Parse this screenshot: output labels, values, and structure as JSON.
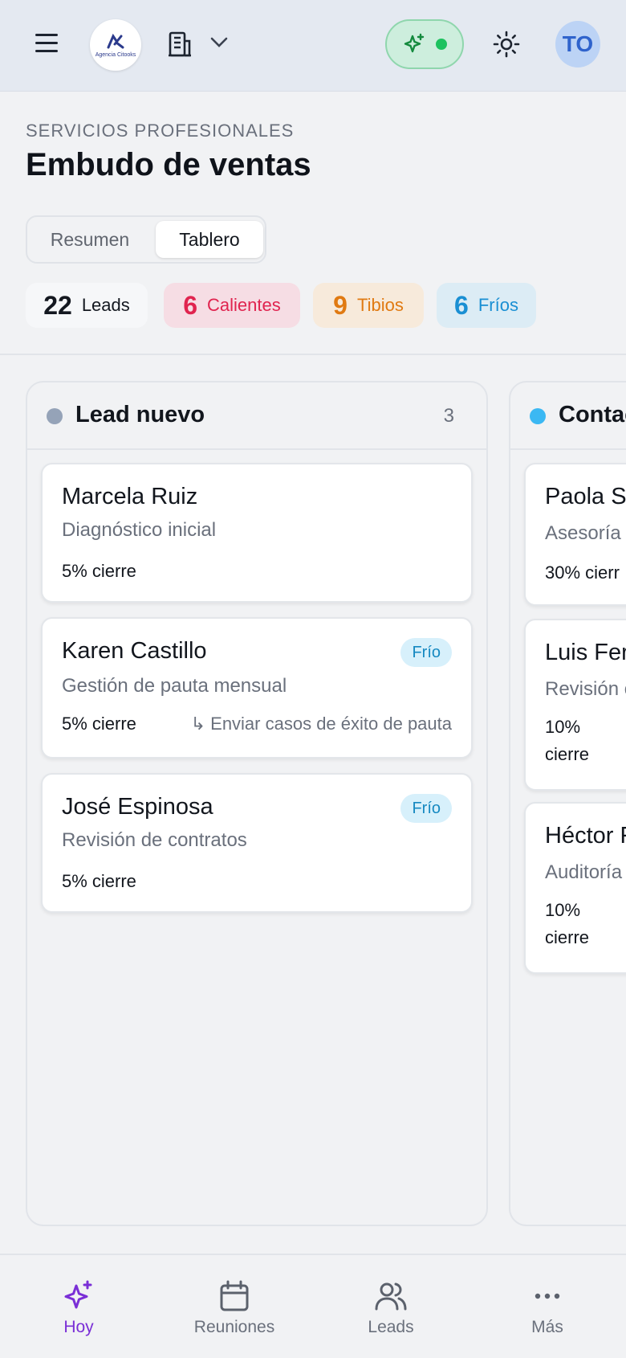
{
  "header": {
    "logo_text": "Agencia Citooks",
    "avatar_initials": "TO"
  },
  "page": {
    "eyebrow": "SERVICIOS PROFESIONALES",
    "title": "Embudo de ventas",
    "tabs": [
      {
        "label": "Resumen",
        "active": false
      },
      {
        "label": "Tablero",
        "active": true
      }
    ]
  },
  "stats": [
    {
      "value": "22",
      "label": "Leads",
      "color": "#141820",
      "bg": "#f6f7f9"
    },
    {
      "value": "6",
      "label": "Calientes",
      "color": "#e0244f",
      "bg": "#f6dde4"
    },
    {
      "value": "9",
      "label": "Tibios",
      "color": "#e07a12",
      "bg": "#f7eadb"
    },
    {
      "value": "6",
      "label": "Fríos",
      "color": "#1a8fd3",
      "bg": "#dcecf5"
    }
  ],
  "columns": [
    {
      "title": "Lead nuevo",
      "count": "3",
      "dot_color": "#95a3b8",
      "cards": [
        {
          "name": "Marcela Ruiz",
          "sub": "Diagnóstico inicial",
          "pct": "5% cierre",
          "badge": "",
          "next": ""
        },
        {
          "name": "Karen Castillo",
          "sub": "Gestión de pauta mensual",
          "pct": "5% cierre",
          "badge": "Frío",
          "next": "↳ Enviar casos de éxito de pauta"
        },
        {
          "name": "José Espinosa",
          "sub": "Revisión de contratos",
          "pct": "5% cierre",
          "badge": "Frío",
          "next": ""
        }
      ]
    },
    {
      "title": "Contac",
      "count": "",
      "dot_color": "#3bb8f3",
      "cards": [
        {
          "name": "Paola Sa",
          "sub": "Asesoría",
          "pct": "30% cierr"
        },
        {
          "name": "Luis Fer",
          "sub": "Revisión c",
          "pct": "10% cierre"
        },
        {
          "name": "Héctor F",
          "sub": "Auditoría",
          "pct": "10% cierre"
        }
      ]
    }
  ],
  "bottom_nav": [
    {
      "label": "Hoy",
      "icon": "sparkle-icon",
      "active": true
    },
    {
      "label": "Reuniones",
      "icon": "calendar-icon",
      "active": false
    },
    {
      "label": "Leads",
      "icon": "users-icon",
      "active": false
    },
    {
      "label": "Más",
      "icon": "more-icon",
      "active": false
    }
  ],
  "colors": {
    "accent": "#7a2fd6",
    "status_online": "#1dc25f"
  }
}
